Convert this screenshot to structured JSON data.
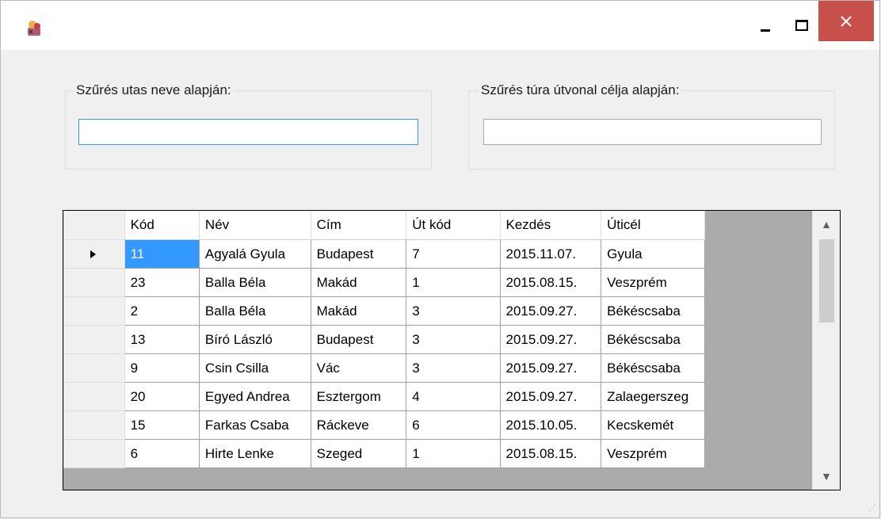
{
  "window": {
    "icon": "app-icon",
    "controls": {
      "minimize": "minimize-icon",
      "maximize": "maximize-icon",
      "close": "✕"
    }
  },
  "filters": {
    "name": {
      "label": "Szűrés utas neve alapján:",
      "value": ""
    },
    "destination": {
      "label": "Szűrés túra útvonal célja alapján:",
      "value": ""
    }
  },
  "grid": {
    "columns": [
      "Kód",
      "Név",
      "Cím",
      "Út kód",
      "Kezdés",
      "Úticél"
    ],
    "rows": [
      [
        "11",
        "Agyalá Gyula",
        "Budapest",
        "7",
        "2015.11.07.",
        "Gyula"
      ],
      [
        "23",
        "Balla Béla",
        "Makád",
        "1",
        "2015.08.15.",
        "Veszprém"
      ],
      [
        "2",
        "Balla Béla",
        "Makád",
        "3",
        "2015.09.27.",
        "Békéscsaba"
      ],
      [
        "13",
        "Bíró László",
        "Budapest",
        "3",
        "2015.09.27.",
        "Békéscsaba"
      ],
      [
        "9",
        "Csin Csilla",
        "Vác",
        "3",
        "2015.09.27.",
        "Békéscsaba"
      ],
      [
        "20",
        "Egyed Andrea",
        "Esztergom",
        "4",
        "2015.09.27.",
        "Zalaegerszeg"
      ],
      [
        "15",
        "Farkas Csaba",
        "Ráckeve",
        "6",
        "2015.10.05.",
        "Kecskemét"
      ],
      [
        "6",
        "Hirte Lenke",
        "Szeged",
        "1",
        "2015.08.15.",
        "Veszprém"
      ]
    ],
    "selected_row": 0,
    "scrollbar": {
      "up": "▲",
      "down": "▼"
    }
  },
  "colors": {
    "selection": "#3399ff",
    "close_button": "#c7504a",
    "grid_background": "#ababab"
  }
}
